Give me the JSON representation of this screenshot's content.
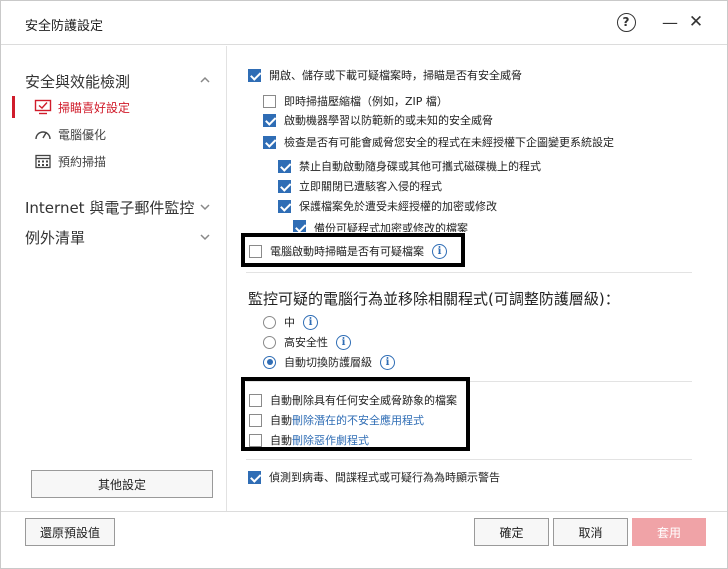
{
  "window": {
    "title": "安全防護設定",
    "help_glyph": "?",
    "minimize_glyph": "—",
    "close_glyph": "✕"
  },
  "sidebar": {
    "sections": [
      {
        "label": "安全與效能檢測",
        "expanded": true
      },
      {
        "label": "Internet 與電子郵件監控",
        "expanded": false
      },
      {
        "label": "例外清單",
        "expanded": false
      }
    ],
    "sub_items": [
      {
        "label": "掃瞄喜好設定",
        "icon": "monitor-check-icon",
        "active": true
      },
      {
        "label": "電腦優化",
        "icon": "gauge-icon",
        "active": false
      },
      {
        "label": "預約掃描",
        "icon": "calendar-icon",
        "active": false
      }
    ],
    "other_settings_label": "其他設定",
    "accent_color": "#d01c2b"
  },
  "content": {
    "options": [
      {
        "label": "開啟、儲存或下載可疑檔案時，掃瞄是否有安全威脅",
        "checked": true
      },
      {
        "label": "即時掃描壓縮檔（例如，ZIP 檔）",
        "checked": false
      },
      {
        "label": "啟動機器學習以防範新的或未知的安全威脅",
        "checked": true
      },
      {
        "label": "檢查是否有可能會威脅您安全的程式在未經授權下企圖變更系統設定",
        "checked": true
      },
      {
        "label": "禁止自動啟動隨身碟或其他可攜式磁碟機上的程式",
        "checked": true
      },
      {
        "label": "立即關閉已遭駭客入侵的程式",
        "checked": true
      },
      {
        "label": "保護檔案免於遭受未經授權的加密或修改",
        "checked": true
      },
      {
        "label": "備份可疑程式加密或修改的檔案",
        "checked": true
      }
    ],
    "startup_scan": {
      "label": "電腦啟動時掃瞄是否有可疑檔案",
      "checked": false
    },
    "monitor_title": "監控可疑的電腦行為並移除相關程式(可調整防護層級)：",
    "radios": [
      {
        "label": "中",
        "selected": false
      },
      {
        "label": "高安全性",
        "selected": false
      },
      {
        "label": "自動切換防護層級",
        "selected": true
      }
    ],
    "auto_delete": [
      {
        "label": "自動刪除具有任何安全威脅跡象的檔案",
        "checked": false
      },
      {
        "label_prefix": "自動",
        "label_link": "刪除潛在的不安全應用程式",
        "checked": false
      },
      {
        "label_prefix": "自動",
        "label_link": "刪除惡作劇程式",
        "checked": false
      }
    ],
    "warning": {
      "label": "偵測到病毒、間諜程式或可疑行為為時顯示警告",
      "checked": true
    },
    "accent_color": "#2f6db5"
  },
  "footer": {
    "restore_label": "還原預設值",
    "ok_label": "確定",
    "cancel_label": "取消",
    "apply_label": "套用"
  }
}
